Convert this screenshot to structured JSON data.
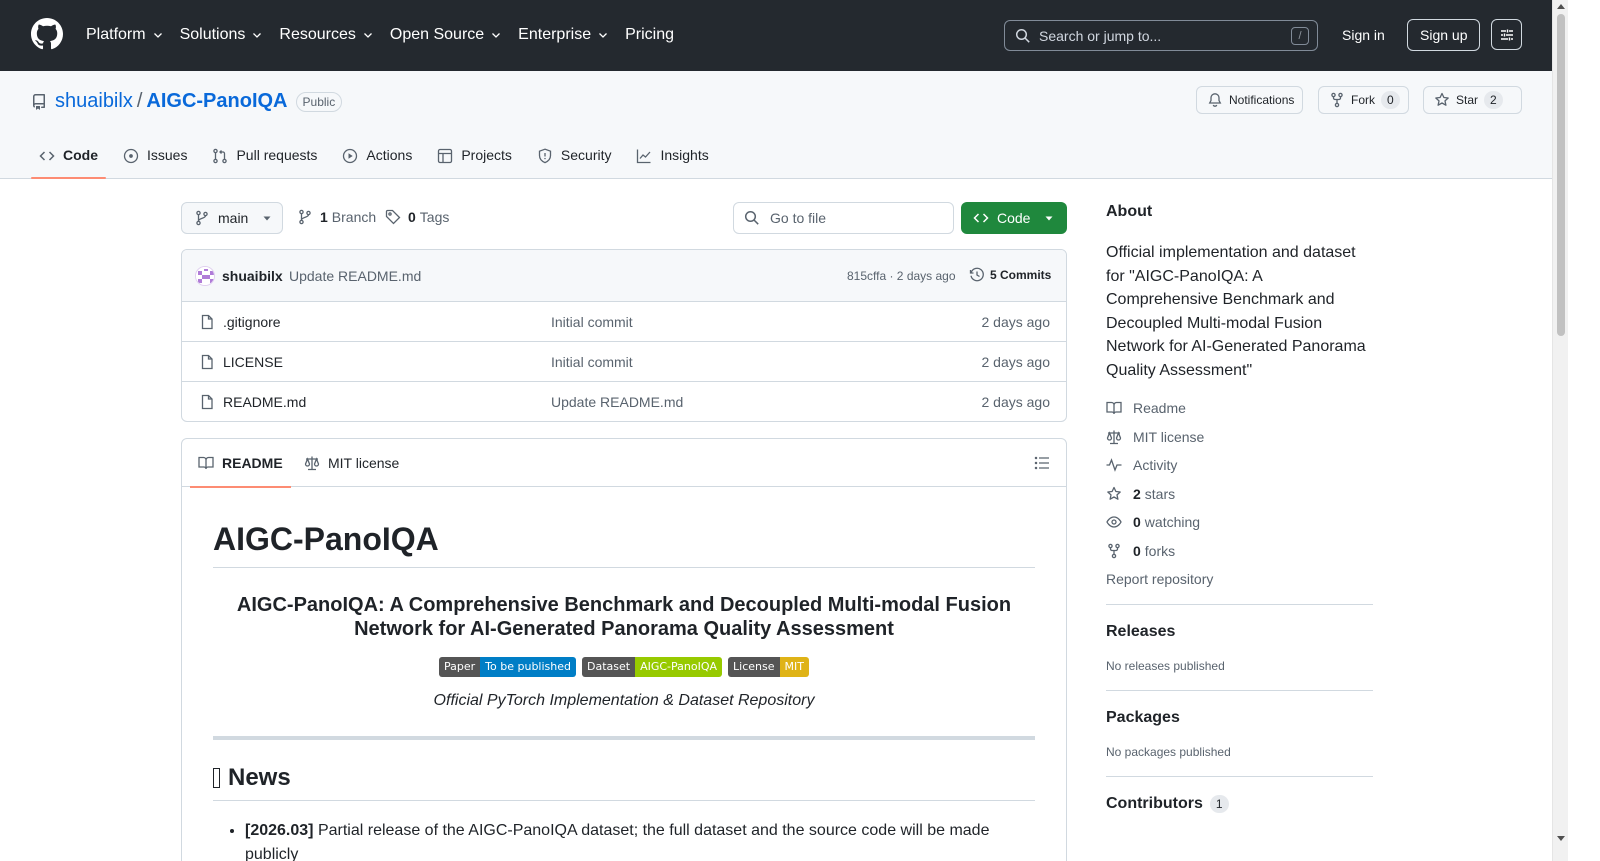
{
  "header": {
    "nav": [
      "Platform",
      "Solutions",
      "Resources",
      "Open Source",
      "Enterprise",
      "Pricing"
    ],
    "search_placeholder": "Search or jump to...",
    "search_shortcut": "/",
    "sign_in": "Sign in",
    "sign_up": "Sign up"
  },
  "repo": {
    "owner": "shuaibilx",
    "separator": "/",
    "name": "AIGC-PanoIQA",
    "visibility": "Public",
    "notifications_label": "Notifications",
    "fork_label": "Fork",
    "fork_count": "0",
    "star_label": "Star",
    "star_count": "2"
  },
  "tabs": [
    "Code",
    "Issues",
    "Pull requests",
    "Actions",
    "Projects",
    "Security",
    "Insights"
  ],
  "toolbar": {
    "branch": "main",
    "branch_count": "1",
    "branch_label": "Branch",
    "tag_count": "0",
    "tag_label": "Tags",
    "goto_placeholder": "Go to file",
    "code_button": "Code"
  },
  "commit": {
    "author": "shuaibilx",
    "message": "Update README.md",
    "hash_time": "815cffa · 2 days ago",
    "commits": "5 Commits"
  },
  "files": [
    {
      "name": ".gitignore",
      "message": "Initial commit",
      "age": "2 days ago"
    },
    {
      "name": "LICENSE",
      "message": "Initial commit",
      "age": "2 days ago"
    },
    {
      "name": "README.md",
      "message": "Update README.md",
      "age": "2 days ago"
    }
  ],
  "readme": {
    "tab_readme": "README",
    "tab_license": "MIT license",
    "title": "AIGC-PanoIQA",
    "subtitle": "AIGC-PanoIQA: A Comprehensive Benchmark and Decoupled Multi-modal Fusion Network for AI-Generated Panorama Quality Assessment",
    "badges": [
      {
        "label": "Paper",
        "value": "To be published",
        "color": "#007ec6"
      },
      {
        "label": "Dataset",
        "value": "AIGC-PanoIQA",
        "color": "#97ca00"
      },
      {
        "label": "License",
        "value": "MIT",
        "color": "#dfb317"
      }
    ],
    "tagline": "Official PyTorch Implementation & Dataset Repository",
    "news_heading": "News",
    "news": [
      {
        "date": "[2026.03]",
        "text": "Partial release of the AIGC-PanoIQA dataset; the full dataset and the source code will be made publicly"
      }
    ]
  },
  "sidebar": {
    "about_heading": "About",
    "description": "Official implementation and dataset for \"AIGC-PanoIQA: A Comprehensive Benchmark and Decoupled Multi-modal Fusion Network for AI-Generated Panorama Quality Assessment\"",
    "items": [
      {
        "icon": "book-icon",
        "bold": "",
        "label": "Readme"
      },
      {
        "icon": "law-icon",
        "bold": "",
        "label": "MIT license"
      },
      {
        "icon": "pulse-icon",
        "bold": "",
        "label": "Activity"
      },
      {
        "icon": "star-icon",
        "bold": "2",
        "label": "stars"
      },
      {
        "icon": "eye-icon",
        "bold": "0",
        "label": "watching"
      },
      {
        "icon": "fork-icon",
        "bold": "0",
        "label": "forks"
      }
    ],
    "report": "Report repository",
    "releases_heading": "Releases",
    "releases_text": "No releases published",
    "packages_heading": "Packages",
    "packages_text": "No packages published",
    "contributors_heading": "Contributors",
    "contributors_count": "1"
  },
  "colors": {
    "header_bg": "#24292f",
    "link": "#0969da",
    "primary_button": "#1f883d",
    "tab_underline": "#fd8c73"
  }
}
